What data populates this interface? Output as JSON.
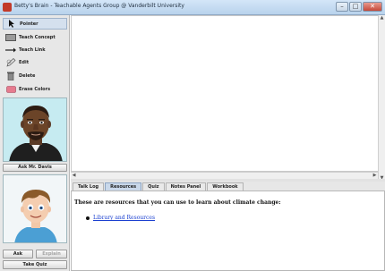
{
  "window": {
    "title": "Betty's Brain - Teachable Agents Group @ Vanderbilt University",
    "controls": [
      "–",
      "□",
      "✕"
    ]
  },
  "toolbar": {
    "items": [
      {
        "label": "Pointer",
        "icon": "pointer-arrow-icon"
      },
      {
        "label": "Teach Concept",
        "icon": "concept-box-icon"
      },
      {
        "label": "Teach Link",
        "icon": "link-arrow-icon"
      },
      {
        "label": "Edit",
        "icon": "edit-pen-icon"
      },
      {
        "label": "Delete",
        "icon": "trash-icon"
      },
      {
        "label": "Erase Colors",
        "icon": "eraser-icon"
      }
    ],
    "selected": "Pointer"
  },
  "mentor": {
    "button_label": "Ask Mr. Davis"
  },
  "student": {
    "ask_label": "Ask",
    "explain_label": "Explain",
    "take_quiz_label": "Take Quiz"
  },
  "tabs": {
    "items": [
      "Talk Log",
      "Resources",
      "Quiz",
      "Notes Panel",
      "Workbook"
    ],
    "active": "Resources"
  },
  "resources": {
    "intro": "These are resources that you can use to learn about climate change:",
    "link_label": "Library and Resources"
  },
  "colors": {
    "portrait_bg": "#c6ebf1",
    "active_tab": "#c9d8ea",
    "link": "#1a3fd0"
  }
}
